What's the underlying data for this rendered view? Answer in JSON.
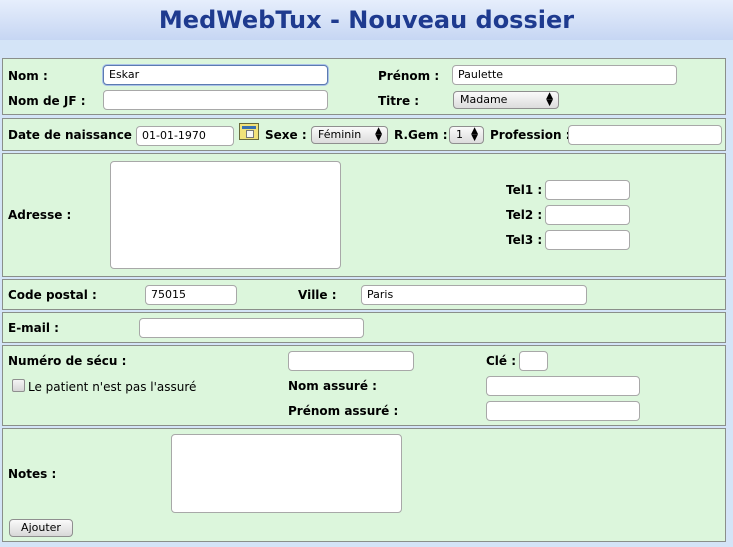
{
  "window": {
    "title": "MedWebTux - Nouveau dossier"
  },
  "identity": {
    "nom_label": "Nom :",
    "nom_value": "Eskar",
    "prenom_label": "Prénom :",
    "prenom_value": "Paulette",
    "nomjf_label": "Nom de JF :",
    "nomjf_value": "",
    "titre_label": "Titre :",
    "titre_value": "Madame"
  },
  "birth": {
    "dob_label": "Date de naissance :",
    "dob_value": "01-01-1970",
    "calendar_icon": "calendar-icon",
    "sexe_label": "Sexe :",
    "sexe_value": "Féminin",
    "rgem_label": "R.Gem :",
    "rgem_value": "1",
    "profession_label": "Profession :",
    "profession_value": ""
  },
  "address": {
    "adresse_label": "Adresse :",
    "tel1_label": "Tel1 :",
    "tel2_label": "Tel2 :",
    "tel3_label": "Tel3 :"
  },
  "location": {
    "cp_label": "Code postal :",
    "cp_value": "75015",
    "ville_label": "Ville :",
    "ville_value": "Paris"
  },
  "email": {
    "label": "E-mail :",
    "value": ""
  },
  "secu": {
    "numero_label": "Numéro de sécu :",
    "cle_label": "Clé :",
    "not_insured_label": "Le patient n'est pas l'assuré",
    "not_insured_checked": false,
    "nom_assure_label": "Nom assuré :",
    "prenom_assure_label": "Prénom assuré :"
  },
  "notes": {
    "label": "Notes :"
  },
  "actions": {
    "ajouter_label": "Ajouter"
  },
  "colors": {
    "section_bg": "#dcf6dc",
    "title_color": "#1e3a8f",
    "page_bg": "#d4e4f7"
  }
}
